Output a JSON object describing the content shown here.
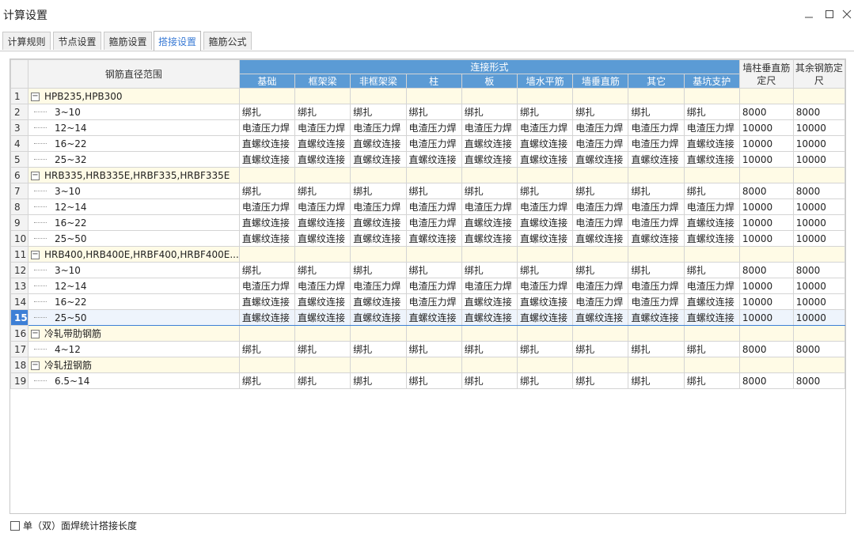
{
  "window": {
    "title": "计算设置"
  },
  "tabs": [
    {
      "label": "计算规则",
      "active": false
    },
    {
      "label": "节点设置",
      "active": false
    },
    {
      "label": "箍筋设置",
      "active": false
    },
    {
      "label": "搭接设置",
      "active": true
    },
    {
      "label": "箍筋公式",
      "active": false
    }
  ],
  "grid": {
    "header_range": "钢筋直径范围",
    "header_group": "连接形式",
    "columns": [
      "基础",
      "框架梁",
      "非框架梁",
      "柱",
      "板",
      "墙水平筋",
      "墙垂直筋",
      "其它",
      "基坑支护"
    ],
    "header_wall": "墙柱垂直筋定尺",
    "header_other": "其余钢筋定尺",
    "rows": [
      {
        "n": "1",
        "group": true,
        "name": "HPB235,HPB300"
      },
      {
        "n": "2",
        "name": "3~10",
        "cells": [
          "绑扎",
          "绑扎",
          "绑扎",
          "绑扎",
          "绑扎",
          "绑扎",
          "绑扎",
          "绑扎",
          "绑扎"
        ],
        "wall": "8000",
        "other": "8000"
      },
      {
        "n": "3",
        "name": "12~14",
        "cells": [
          "电渣压力焊",
          "电渣压力焊",
          "电渣压力焊",
          "电渣压力焊",
          "电渣压力焊",
          "电渣压力焊",
          "电渣压力焊",
          "电渣压力焊",
          "电渣压力焊"
        ],
        "wall": "10000",
        "other": "10000"
      },
      {
        "n": "4",
        "name": "16~22",
        "cells": [
          "直螺纹连接",
          "直螺纹连接",
          "直螺纹连接",
          "电渣压力焊",
          "直螺纹连接",
          "直螺纹连接",
          "电渣压力焊",
          "电渣压力焊",
          "直螺纹连接"
        ],
        "wall": "10000",
        "other": "10000"
      },
      {
        "n": "5",
        "name": "25~32",
        "cells": [
          "直螺纹连接",
          "直螺纹连接",
          "直螺纹连接",
          "直螺纹连接",
          "直螺纹连接",
          "直螺纹连接",
          "直螺纹连接",
          "直螺纹连接",
          "直螺纹连接"
        ],
        "wall": "10000",
        "other": "10000"
      },
      {
        "n": "6",
        "group": true,
        "name": "HRB335,HRB335E,HRBF335,HRBF335E"
      },
      {
        "n": "7",
        "name": "3~10",
        "cells": [
          "绑扎",
          "绑扎",
          "绑扎",
          "绑扎",
          "绑扎",
          "绑扎",
          "绑扎",
          "绑扎",
          "绑扎"
        ],
        "wall": "8000",
        "other": "8000"
      },
      {
        "n": "8",
        "name": "12~14",
        "cells": [
          "电渣压力焊",
          "电渣压力焊",
          "电渣压力焊",
          "电渣压力焊",
          "电渣压力焊",
          "电渣压力焊",
          "电渣压力焊",
          "电渣压力焊",
          "电渣压力焊"
        ],
        "wall": "10000",
        "other": "10000"
      },
      {
        "n": "9",
        "name": "16~22",
        "cells": [
          "直螺纹连接",
          "直螺纹连接",
          "直螺纹连接",
          "电渣压力焊",
          "直螺纹连接",
          "直螺纹连接",
          "电渣压力焊",
          "电渣压力焊",
          "直螺纹连接"
        ],
        "wall": "10000",
        "other": "10000"
      },
      {
        "n": "10",
        "name": "25~50",
        "cells": [
          "直螺纹连接",
          "直螺纹连接",
          "直螺纹连接",
          "直螺纹连接",
          "直螺纹连接",
          "直螺纹连接",
          "直螺纹连接",
          "直螺纹连接",
          "直螺纹连接"
        ],
        "wall": "10000",
        "other": "10000"
      },
      {
        "n": "11",
        "group": true,
        "name": "HRB400,HRB400E,HRBF400,HRBF400E..."
      },
      {
        "n": "12",
        "name": "3~10",
        "cells": [
          "绑扎",
          "绑扎",
          "绑扎",
          "绑扎",
          "绑扎",
          "绑扎",
          "绑扎",
          "绑扎",
          "绑扎"
        ],
        "wall": "8000",
        "other": "8000"
      },
      {
        "n": "13",
        "name": "12~14",
        "cells": [
          "电渣压力焊",
          "电渣压力焊",
          "电渣压力焊",
          "电渣压力焊",
          "电渣压力焊",
          "电渣压力焊",
          "电渣压力焊",
          "电渣压力焊",
          "电渣压力焊"
        ],
        "wall": "10000",
        "other": "10000"
      },
      {
        "n": "14",
        "name": "16~22",
        "cells": [
          "直螺纹连接",
          "直螺纹连接",
          "直螺纹连接",
          "电渣压力焊",
          "直螺纹连接",
          "直螺纹连接",
          "电渣压力焊",
          "电渣压力焊",
          "直螺纹连接"
        ],
        "wall": "10000",
        "other": "10000"
      },
      {
        "n": "15",
        "name": "25~50",
        "selected": true,
        "cells": [
          "直螺纹连接",
          "直螺纹连接",
          "直螺纹连接",
          "直螺纹连接",
          "直螺纹连接",
          "直螺纹连接",
          "直螺纹连接",
          "直螺纹连接",
          "直螺纹连接"
        ],
        "wall": "10000",
        "other": "10000"
      },
      {
        "n": "16",
        "group": true,
        "name": "冷轧带肋钢筋"
      },
      {
        "n": "17",
        "name": "4~12",
        "cells": [
          "绑扎",
          "绑扎",
          "绑扎",
          "绑扎",
          "绑扎",
          "绑扎",
          "绑扎",
          "绑扎",
          "绑扎"
        ],
        "wall": "8000",
        "other": "8000"
      },
      {
        "n": "18",
        "group": true,
        "name": "冷轧扭钢筋"
      },
      {
        "n": "19",
        "name": "6.5~14",
        "cells": [
          "绑扎",
          "绑扎",
          "绑扎",
          "绑扎",
          "绑扎",
          "绑扎",
          "绑扎",
          "绑扎",
          "绑扎"
        ],
        "wall": "8000",
        "other": "8000"
      }
    ]
  },
  "footer": {
    "checkbox_label": "单（双）面焊统计搭接长度",
    "checked": false
  },
  "icons": {
    "minimize": "minimize-icon",
    "maximize": "maximize-icon",
    "close": "close-icon",
    "collapse": "collapse-minus-icon"
  }
}
